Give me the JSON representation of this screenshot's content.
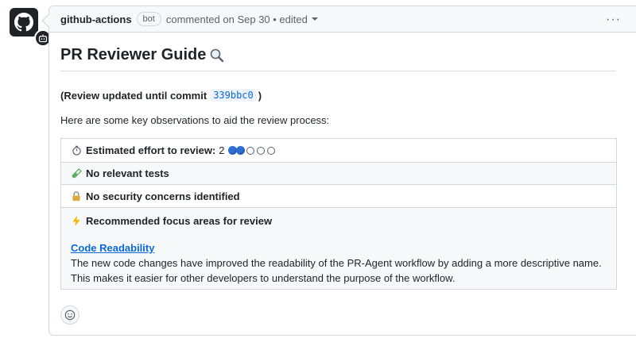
{
  "comment": {
    "author": "github-actions",
    "author_badge": "bot",
    "meta": "commented on Sep 30 • edited",
    "more_actions_label": "···"
  },
  "body": {
    "title": "PR Reviewer Guide",
    "title_icon": "magnifier-icon",
    "review_prefix": "(Review updated until commit",
    "commit_hash": "339bbc0",
    "review_suffix": ")",
    "observations_intro": "Here are some key observations to aid the review process:"
  },
  "table": {
    "effort_label": "Estimated effort to review:",
    "effort_value": "2",
    "effort_level": 2,
    "effort_max": 5,
    "tests_label": "No relevant tests",
    "security_label": "No security concerns identified",
    "focus_label": "Recommended focus areas for review",
    "focus_link": "Code Readability",
    "focus_description": "The new code changes have improved the readability of the PR-Agent workflow by adding a more descriptive name. This makes it easier for other developers to understand the purpose of the workflow."
  },
  "icons": {
    "effort": "stopwatch-icon",
    "tests": "test-tube-icon",
    "security": "lock-icon",
    "focus": "lightning-icon",
    "reaction": "smiley-icon"
  },
  "colors": {
    "link": "#0969da",
    "border": "#d0d7de",
    "header_bg": "#f6f8fa",
    "effort_dot": "#2e6fd6"
  }
}
